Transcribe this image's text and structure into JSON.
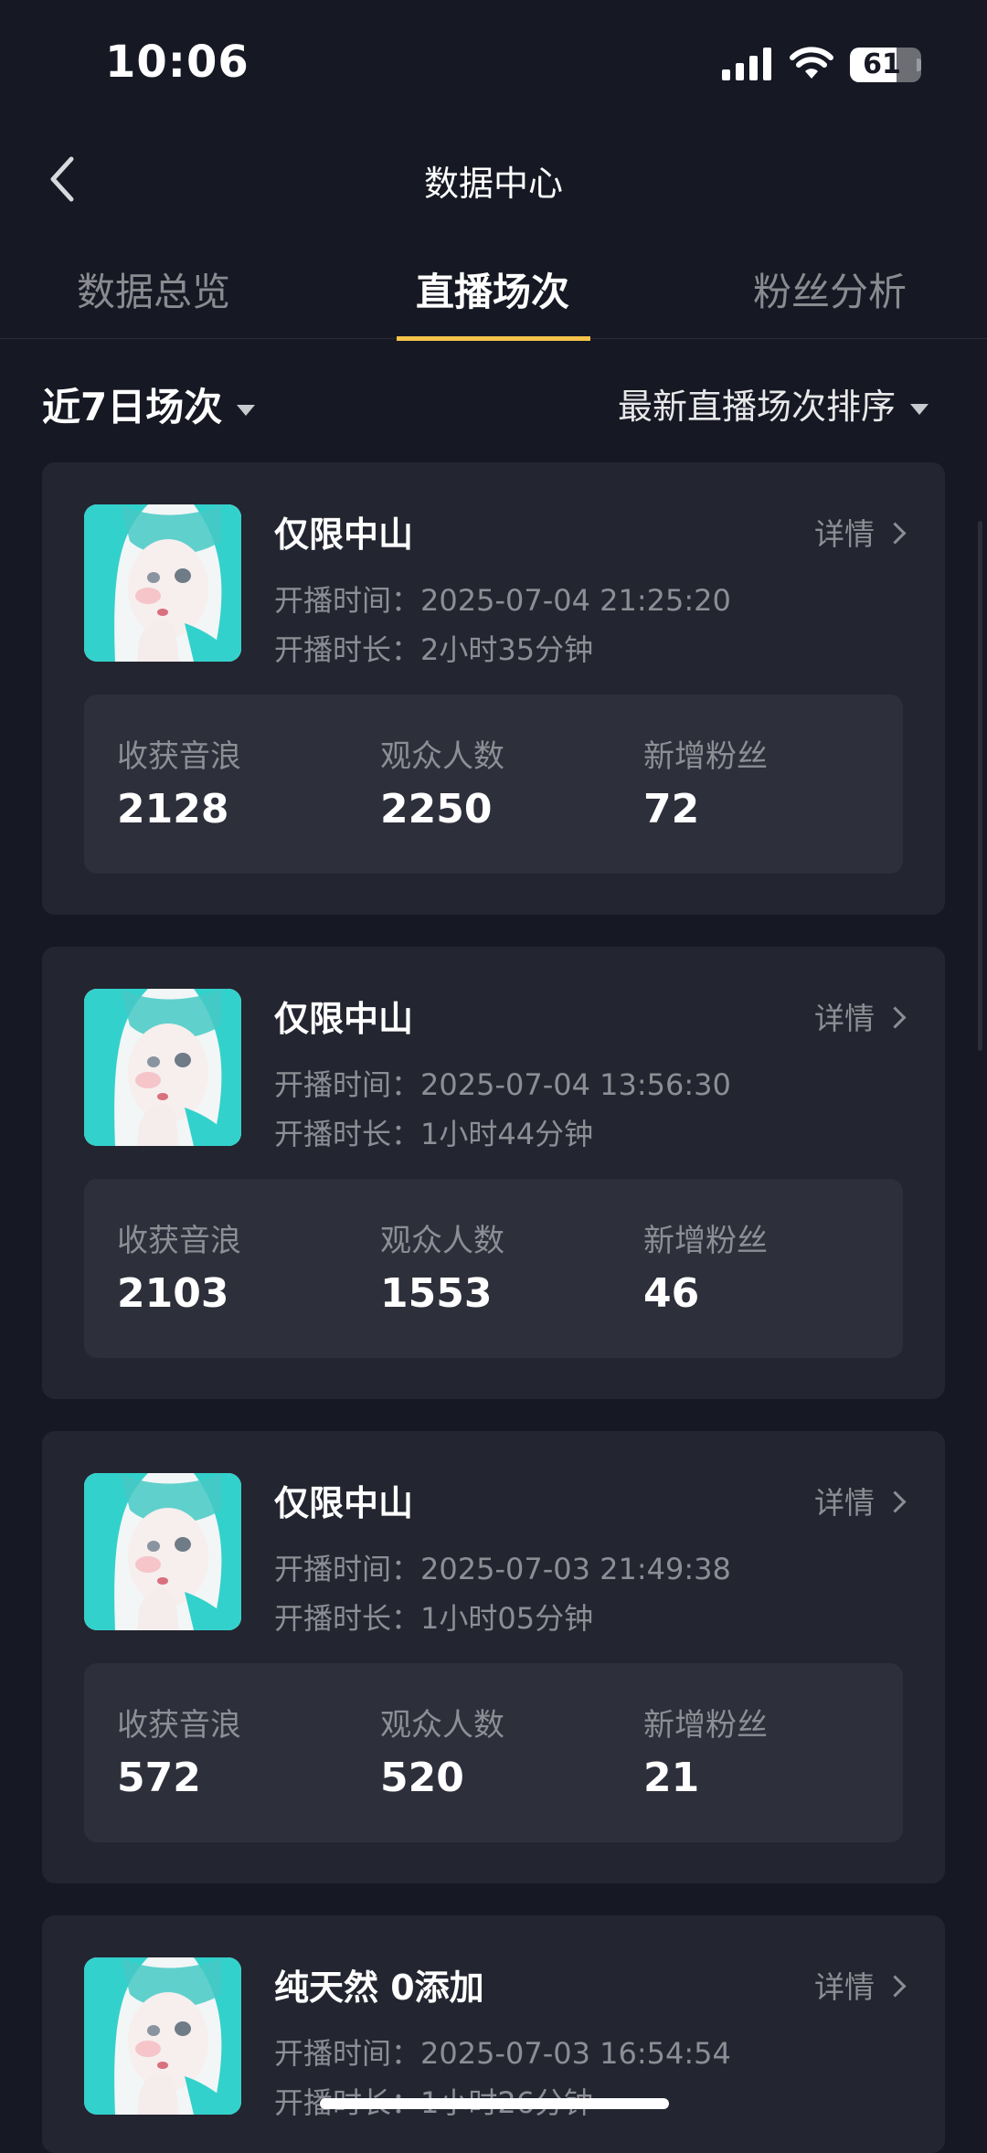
{
  "status_bar": {
    "time": "10:06",
    "battery": "61",
    "battery_level": 0.61
  },
  "nav": {
    "title": "数据中心"
  },
  "tabs": [
    {
      "label": "数据总览",
      "active": false
    },
    {
      "label": "直播场次",
      "active": true
    },
    {
      "label": "粉丝分析",
      "active": false
    }
  ],
  "filter": {
    "range_label": "近7日场次",
    "sort_label": "最新直播场次排序"
  },
  "colors": {
    "background": "#161823",
    "card": "#232530",
    "stats_panel": "#2d2f3a",
    "accent": "#f6c44a",
    "avatar_teal": "#33d1cc"
  },
  "icons": {
    "back": "chevron-left-icon",
    "detail": "chevron-right-icon",
    "dropdown": "caret-down-icon"
  },
  "sessions": [
    {
      "title": "仅限中山",
      "detail": "详情",
      "start_time": "开播时间：2025-07-04 21:25:20",
      "duration": "开播时长：2小时35分钟",
      "stats": [
        {
          "label": "收获音浪",
          "value": "2128"
        },
        {
          "label": "观众人数",
          "value": "2250"
        },
        {
          "label": "新增粉丝",
          "value": "72"
        }
      ]
    },
    {
      "title": "仅限中山",
      "detail": "详情",
      "start_time": "开播时间：2025-07-04 13:56:30",
      "duration": "开播时长：1小时44分钟",
      "stats": [
        {
          "label": "收获音浪",
          "value": "2103"
        },
        {
          "label": "观众人数",
          "value": "1553"
        },
        {
          "label": "新增粉丝",
          "value": "46"
        }
      ]
    },
    {
      "title": "仅限中山",
      "detail": "详情",
      "start_time": "开播时间：2025-07-03 21:49:38",
      "duration": "开播时长：1小时05分钟",
      "stats": [
        {
          "label": "收获音浪",
          "value": "572"
        },
        {
          "label": "观众人数",
          "value": "520"
        },
        {
          "label": "新增粉丝",
          "value": "21"
        }
      ]
    },
    {
      "title": "纯天然 0添加",
      "detail": "详情",
      "start_time": "开播时间：2025-07-03 16:54:54",
      "duration": "开播时长：1小时26分钟"
    }
  ]
}
